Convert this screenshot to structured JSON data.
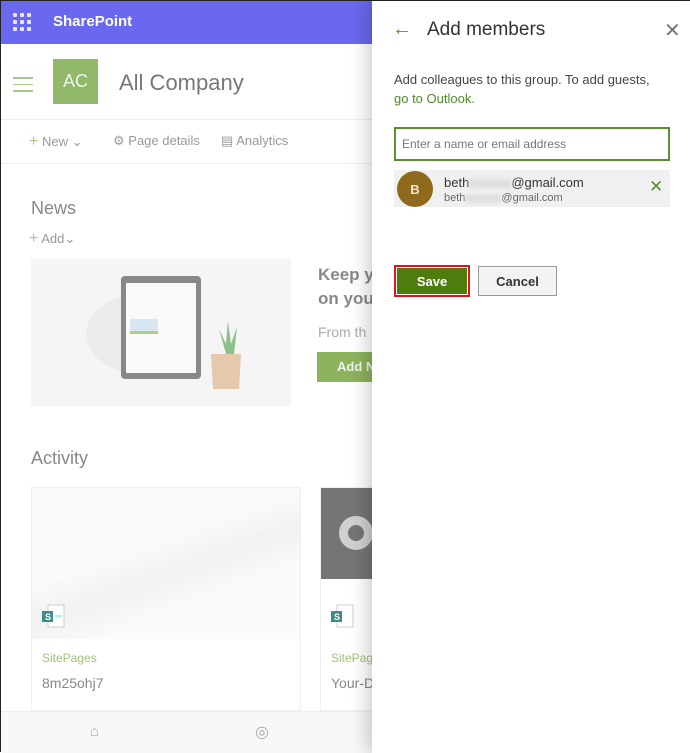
{
  "header": {
    "app_name": "SharePoint",
    "color": "#6a68ef"
  },
  "site": {
    "initials": "AC",
    "title": "All Company",
    "logo_color": "#92b86a"
  },
  "commandbar": {
    "new": "New",
    "page_details": "Page details",
    "analytics": "Analytics"
  },
  "news": {
    "heading": "News",
    "add": "Add",
    "promo_title_1": "Keep y",
    "promo_title_2": "on you",
    "promo_text": "From th",
    "promo_button": "Add N"
  },
  "activity": {
    "heading": "Activity",
    "cards": [
      {
        "library": "SitePages",
        "name": "8m25ohj7"
      },
      {
        "library": "SitePag",
        "name": "Your-D"
      }
    ]
  },
  "panel": {
    "title": "Add members",
    "description": "Add colleagues to this group. To add guests,",
    "link": "go to Outlook.",
    "input_placeholder": "Enter a name or email address",
    "members": [
      {
        "initial": "B",
        "name_prefix": "beth",
        "name_suffix": "@gmail.com",
        "email_prefix": "beth",
        "email_suffix": "@gmail.com",
        "avatar_color": "#8f6a1c"
      }
    ],
    "save": "Save",
    "cancel": "Cancel",
    "accent": "#4e7d0e"
  }
}
